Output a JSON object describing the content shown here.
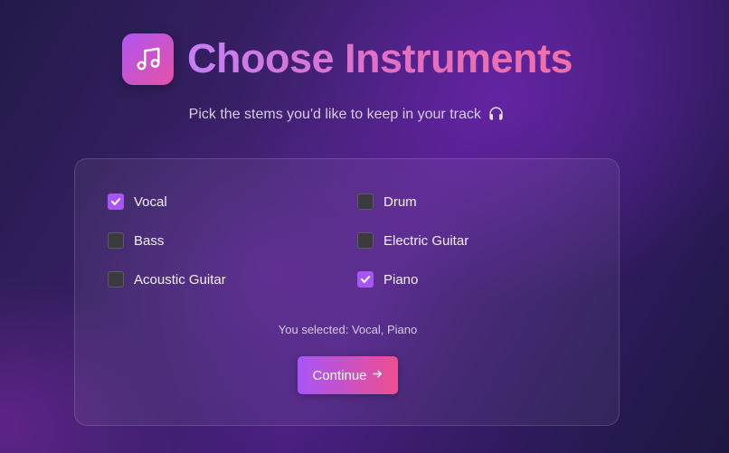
{
  "header": {
    "title": "Choose Instruments",
    "subtitle": "Pick the stems you'd like to keep in your track",
    "logo_icon": "music-note-icon",
    "subtitle_icon": "headphones-icon"
  },
  "options": [
    {
      "label": "Vocal",
      "checked": true
    },
    {
      "label": "Drum",
      "checked": false
    },
    {
      "label": "Bass",
      "checked": false
    },
    {
      "label": "Electric Guitar",
      "checked": false
    },
    {
      "label": "Acoustic Guitar",
      "checked": false
    },
    {
      "label": "Piano",
      "checked": true
    }
  ],
  "summary": "You selected: Vocal, Piano",
  "continue_button": {
    "label": "Continue",
    "icon": "arrow-right-icon"
  },
  "colors": {
    "accent": "#a855f7",
    "accent_end": "#ec4f8f",
    "title_start": "#c47ef5",
    "title_end": "#ef6fa8"
  }
}
